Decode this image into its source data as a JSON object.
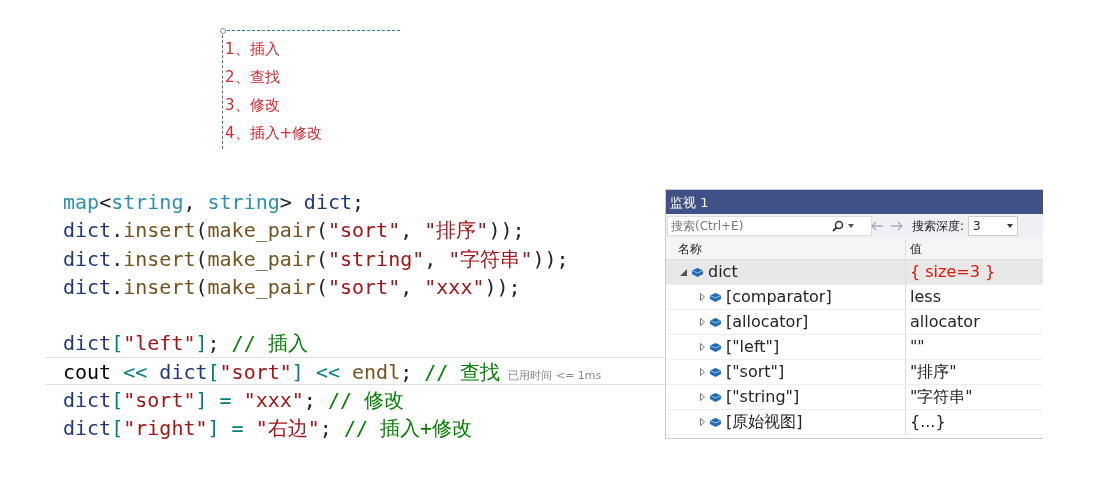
{
  "annotation": {
    "items": [
      "1、插入",
      "2、查找",
      "3、修改",
      "4、插入+修改"
    ]
  },
  "code": {
    "lines": [
      {
        "kind": "code",
        "current": false,
        "tokens": [
          {
            "kind": "type",
            "text": "map"
          },
          {
            "kind": "punct",
            "text": "<"
          },
          {
            "kind": "type",
            "text": "string"
          },
          {
            "kind": "punct",
            "text": ", "
          },
          {
            "kind": "type",
            "text": "string"
          },
          {
            "kind": "punct",
            "text": "> "
          },
          {
            "kind": "var",
            "text": "dict"
          },
          {
            "kind": "punct",
            "text": ";"
          }
        ]
      },
      {
        "kind": "code",
        "current": false,
        "tokens": [
          {
            "kind": "var",
            "text": "dict"
          },
          {
            "kind": "punct",
            "text": "."
          },
          {
            "kind": "func",
            "text": "insert"
          },
          {
            "kind": "punct",
            "text": "("
          },
          {
            "kind": "func",
            "text": "make_pair"
          },
          {
            "kind": "punct",
            "text": "("
          },
          {
            "kind": "str",
            "text": "\"sort\""
          },
          {
            "kind": "punct",
            "text": ", "
          },
          {
            "kind": "str",
            "text": "\"排序\""
          },
          {
            "kind": "punct",
            "text": "));"
          }
        ]
      },
      {
        "kind": "code",
        "current": false,
        "tokens": [
          {
            "kind": "var",
            "text": "dict"
          },
          {
            "kind": "punct",
            "text": "."
          },
          {
            "kind": "func",
            "text": "insert"
          },
          {
            "kind": "punct",
            "text": "("
          },
          {
            "kind": "func",
            "text": "make_pair"
          },
          {
            "kind": "punct",
            "text": "("
          },
          {
            "kind": "str",
            "text": "\"string\""
          },
          {
            "kind": "punct",
            "text": ", "
          },
          {
            "kind": "str",
            "text": "\"字符串\""
          },
          {
            "kind": "punct",
            "text": "));"
          }
        ]
      },
      {
        "kind": "code",
        "current": false,
        "tokens": [
          {
            "kind": "var",
            "text": "dict"
          },
          {
            "kind": "punct",
            "text": "."
          },
          {
            "kind": "func",
            "text": "insert"
          },
          {
            "kind": "punct",
            "text": "("
          },
          {
            "kind": "func",
            "text": "make_pair"
          },
          {
            "kind": "punct",
            "text": "("
          },
          {
            "kind": "str",
            "text": "\"sort\""
          },
          {
            "kind": "punct",
            "text": ", "
          },
          {
            "kind": "str",
            "text": "\"xxx\""
          },
          {
            "kind": "punct",
            "text": "));"
          }
        ]
      },
      {
        "kind": "blank"
      },
      {
        "kind": "code",
        "current": false,
        "tokens": [
          {
            "kind": "var",
            "text": "dict"
          },
          {
            "kind": "op",
            "text": "["
          },
          {
            "kind": "str",
            "text": "\"left\""
          },
          {
            "kind": "op",
            "text": "]"
          },
          {
            "kind": "punct",
            "text": "; "
          },
          {
            "kind": "comment",
            "text": "// 插入"
          }
        ]
      },
      {
        "kind": "code",
        "current": true,
        "hint": "已用时间 <= 1ms",
        "tokens": [
          {
            "kind": "plain",
            "text": "cout "
          },
          {
            "kind": "op",
            "text": "<< "
          },
          {
            "kind": "var",
            "text": "dict"
          },
          {
            "kind": "op",
            "text": "["
          },
          {
            "kind": "str",
            "text": "\"sort\""
          },
          {
            "kind": "op",
            "text": "] << "
          },
          {
            "kind": "func",
            "text": "endl"
          },
          {
            "kind": "punct",
            "text": "; "
          },
          {
            "kind": "comment",
            "text": "// 查找"
          }
        ]
      },
      {
        "kind": "code",
        "current": false,
        "tokens": [
          {
            "kind": "var",
            "text": "dict"
          },
          {
            "kind": "op",
            "text": "["
          },
          {
            "kind": "str",
            "text": "\"sort\""
          },
          {
            "kind": "op",
            "text": "] = "
          },
          {
            "kind": "str",
            "text": "\"xxx\""
          },
          {
            "kind": "punct",
            "text": "; "
          },
          {
            "kind": "comment",
            "text": "// 修改"
          }
        ]
      },
      {
        "kind": "code",
        "current": false,
        "tokens": [
          {
            "kind": "var",
            "text": "dict"
          },
          {
            "kind": "op",
            "text": "["
          },
          {
            "kind": "str",
            "text": "\"right\""
          },
          {
            "kind": "op",
            "text": "] = "
          },
          {
            "kind": "str",
            "text": "\"右边\""
          },
          {
            "kind": "punct",
            "text": "; "
          },
          {
            "kind": "comment",
            "text": "// 插入+修改"
          }
        ]
      }
    ]
  },
  "watch": {
    "title": "监视 1",
    "search": {
      "placeholder": "搜索(Ctrl+E)"
    },
    "depth_label": "搜索深度:",
    "depth": "3",
    "columns": [
      "名称",
      "值"
    ],
    "rows": [
      {
        "name": "dict",
        "value": "{ size=3 }",
        "expanded": true,
        "selected": true,
        "changed": true,
        "children": [
          {
            "name": "[comparator]",
            "value": "less",
            "expanded": false,
            "selected": false,
            "changed": false
          },
          {
            "name": "[allocator]",
            "value": "allocator",
            "expanded": false,
            "selected": false,
            "changed": false
          },
          {
            "name": "[\"left\"]",
            "value": "\"\"",
            "expanded": false,
            "selected": false,
            "changed": false
          },
          {
            "name": "[\"sort\"]",
            "value": "\"排序\"",
            "expanded": false,
            "selected": false,
            "changed": false
          },
          {
            "name": "[\"string\"]",
            "value": "\"字符串\"",
            "expanded": false,
            "selected": false,
            "changed": false
          },
          {
            "name": "[原始视图]",
            "value": "{...}",
            "expanded": false,
            "selected": false,
            "changed": false
          }
        ]
      }
    ]
  }
}
